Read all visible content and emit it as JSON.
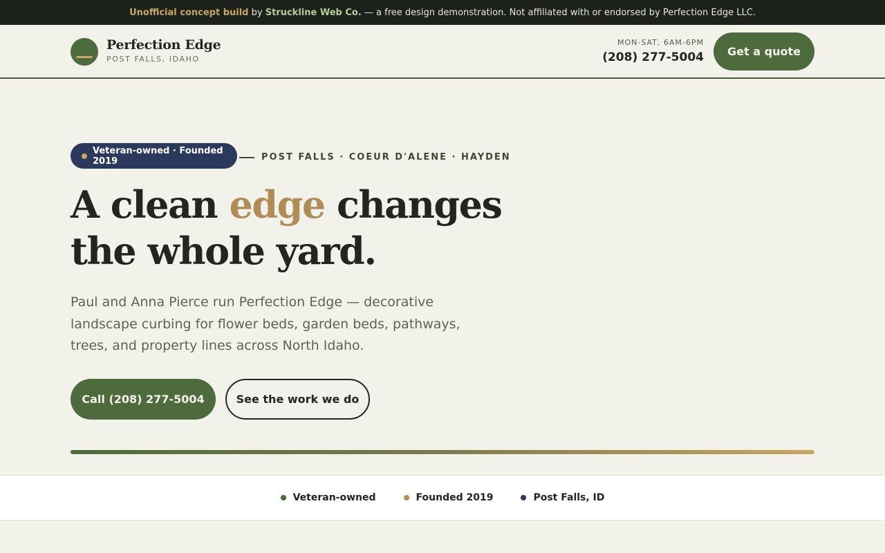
{
  "topbar": {
    "concept": "Unofficial concept build",
    "by": "by",
    "studio": "Struckline Web Co.",
    "disclaimer": "— a free design demonstration. Not affiliated with or endorsed by Perfection Edge LLC."
  },
  "header": {
    "brand_name": "Perfection Edge",
    "brand_location": "POST FALLS, IDAHO",
    "hours": "MON-SAT, 6AM-6PM",
    "phone": "(208) 277-5004",
    "quote_button": "Get a quote"
  },
  "hero": {
    "badge": "Veteran-owned · Founded 2019",
    "areas": "POST FALLS · COEUR D'ALENE · HAYDEN",
    "headline_part1": "A clean ",
    "headline_accent": "edge",
    "headline_part2": " changes the whole yard.",
    "lead": "Paul and Anna Pierce run Perfection Edge — decorative landscape curbing for flower beds, garden beds, pathways, trees, and property lines across North Idaho.",
    "call_button": "Call (208) 277-5004",
    "work_button": "See the work we do"
  },
  "trust": [
    {
      "label": "Veteran-owned",
      "color": "#4e6b3d"
    },
    {
      "label": "Founded 2019",
      "color": "#b08d57"
    },
    {
      "label": "Post Falls, ID",
      "color": "#2b3a5c"
    }
  ],
  "colors": {
    "brand_green": "#4e6b3d",
    "accent_gold": "#b08d57",
    "navy": "#2b3a5c",
    "background": "#f3f2ea"
  }
}
